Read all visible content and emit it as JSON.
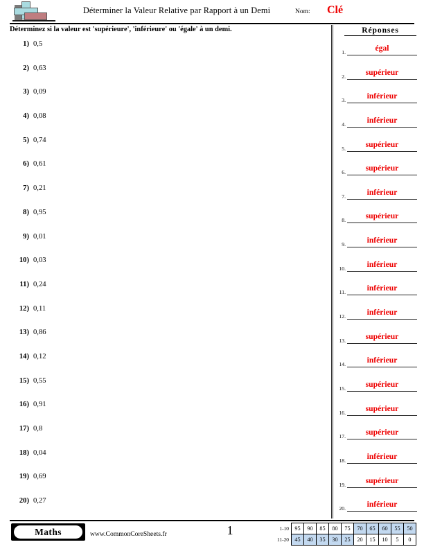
{
  "header": {
    "title": "Déterminer la Valeur Relative par Rapport à un Demi",
    "name_label": "Nom:",
    "name_value": "Clé",
    "logo_icon": "plus-block-logo"
  },
  "instruction": "Déterminez si la valeur est 'supérieure', 'inférieure' ou 'égale' à un demi.",
  "answers_header": "Réponses",
  "questions": [
    {
      "num": "1)",
      "value": "0,5"
    },
    {
      "num": "2)",
      "value": "0,63"
    },
    {
      "num": "3)",
      "value": "0,09"
    },
    {
      "num": "4)",
      "value": "0,08"
    },
    {
      "num": "5)",
      "value": "0,74"
    },
    {
      "num": "6)",
      "value": "0,61"
    },
    {
      "num": "7)",
      "value": "0,21"
    },
    {
      "num": "8)",
      "value": "0,95"
    },
    {
      "num": "9)",
      "value": "0,01"
    },
    {
      "num": "10)",
      "value": "0,03"
    },
    {
      "num": "11)",
      "value": "0,24"
    },
    {
      "num": "12)",
      "value": "0,11"
    },
    {
      "num": "13)",
      "value": "0,86"
    },
    {
      "num": "14)",
      "value": "0,12"
    },
    {
      "num": "15)",
      "value": "0,55"
    },
    {
      "num": "16)",
      "value": "0,91"
    },
    {
      "num": "17)",
      "value": "0,8"
    },
    {
      "num": "18)",
      "value": "0,04"
    },
    {
      "num": "19)",
      "value": "0,69"
    },
    {
      "num": "20)",
      "value": "0,27"
    }
  ],
  "answers": [
    {
      "num": "1.",
      "value": "égal"
    },
    {
      "num": "2.",
      "value": "supérieur"
    },
    {
      "num": "3.",
      "value": "inférieur"
    },
    {
      "num": "4.",
      "value": "inférieur"
    },
    {
      "num": "5.",
      "value": "supérieur"
    },
    {
      "num": "6.",
      "value": "supérieur"
    },
    {
      "num": "7.",
      "value": "inférieur"
    },
    {
      "num": "8.",
      "value": "supérieur"
    },
    {
      "num": "9.",
      "value": "inférieur"
    },
    {
      "num": "10.",
      "value": "inférieur"
    },
    {
      "num": "11.",
      "value": "inférieur"
    },
    {
      "num": "12.",
      "value": "inférieur"
    },
    {
      "num": "13.",
      "value": "supérieur"
    },
    {
      "num": "14.",
      "value": "inférieur"
    },
    {
      "num": "15.",
      "value": "supérieur"
    },
    {
      "num": "16.",
      "value": "supérieur"
    },
    {
      "num": "17.",
      "value": "supérieur"
    },
    {
      "num": "18.",
      "value": "inférieur"
    },
    {
      "num": "19.",
      "value": "supérieur"
    },
    {
      "num": "20.",
      "value": "inférieur"
    }
  ],
  "footer": {
    "subject_badge": "Maths",
    "website": "www.CommonCoreSheets.fr",
    "page_number": "1",
    "scale": {
      "row1_label": "1-10",
      "row2_label": "11-20",
      "row1": [
        {
          "score": "95",
          "highlight": false
        },
        {
          "score": "90",
          "highlight": false
        },
        {
          "score": "85",
          "highlight": false
        },
        {
          "score": "80",
          "highlight": false
        },
        {
          "score": "75",
          "highlight": false
        },
        {
          "score": "70",
          "highlight": true
        },
        {
          "score": "65",
          "highlight": true
        },
        {
          "score": "60",
          "highlight": true
        },
        {
          "score": "55",
          "highlight": true
        },
        {
          "score": "50",
          "highlight": true
        }
      ],
      "row2": [
        {
          "score": "45",
          "highlight": true
        },
        {
          "score": "40",
          "highlight": true
        },
        {
          "score": "35",
          "highlight": true
        },
        {
          "score": "30",
          "highlight": true
        },
        {
          "score": "25",
          "highlight": true
        },
        {
          "score": "20",
          "highlight": false
        },
        {
          "score": "15",
          "highlight": false
        },
        {
          "score": "10",
          "highlight": false
        },
        {
          "score": "5",
          "highlight": false
        },
        {
          "score": "0",
          "highlight": false
        }
      ]
    }
  },
  "colors": {
    "answer_red": "#ee0000",
    "highlight_blue": "#c3d9f0",
    "logo_blue": "#a9dbe0",
    "logo_brick": "#bf7d80"
  }
}
